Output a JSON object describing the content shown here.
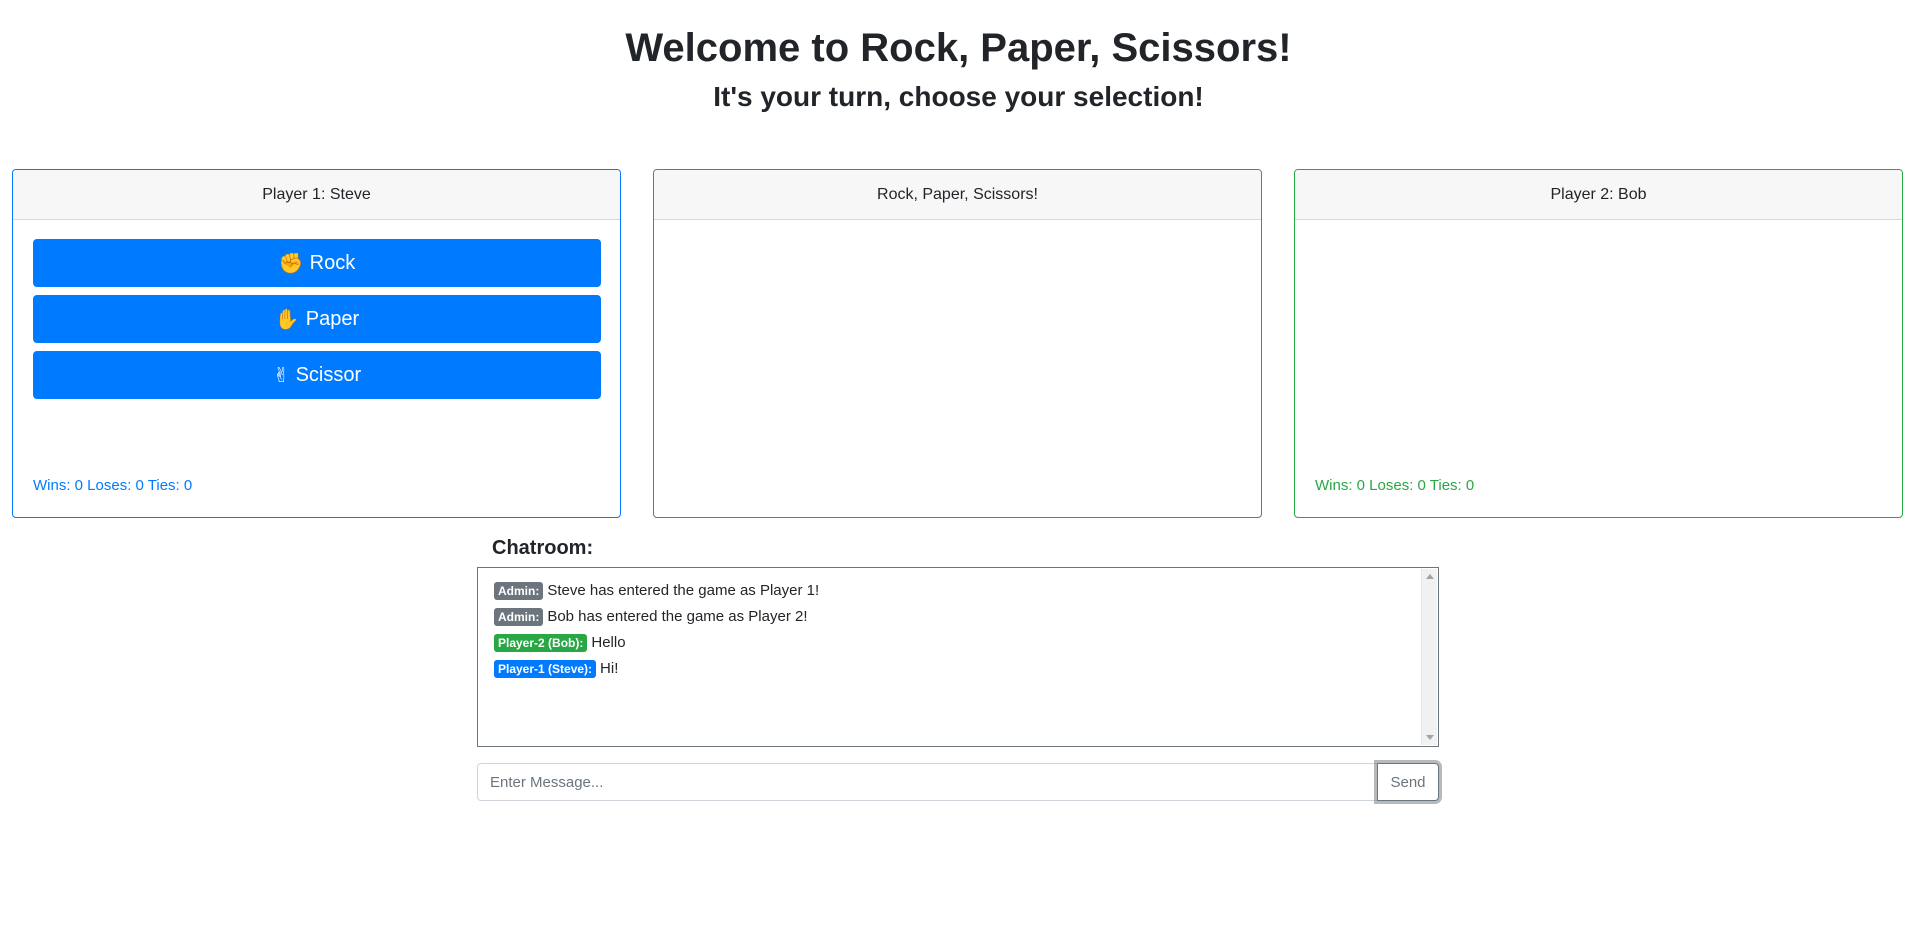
{
  "header": {
    "title": "Welcome to Rock, Paper, Scissors!",
    "subtitle": "It's your turn, choose your selection!"
  },
  "player1": {
    "header": "Player 1: Steve",
    "buttons": [
      {
        "label": "Rock",
        "icon": "hand-rock-icon"
      },
      {
        "label": "Paper",
        "icon": "hand-paper-icon"
      },
      {
        "label": "Scissor",
        "icon": "hand-scissors-icon"
      }
    ],
    "stats": "Wins: 0 Loses: 0 Ties: 0",
    "color": "#007bff"
  },
  "arena": {
    "header": "Rock, Paper, Scissors!"
  },
  "player2": {
    "header": "Player 2: Bob",
    "stats": "Wins: 0 Loses: 0 Ties: 0",
    "color": "#28a745"
  },
  "chat": {
    "label": "Chatroom:",
    "messages": [
      {
        "sender": "Admin:",
        "text": "Steve has entered the game as Player 1!",
        "badge_color": "#6c757d"
      },
      {
        "sender": "Admin:",
        "text": "Bob has entered the game as Player 2!",
        "badge_color": "#6c757d"
      },
      {
        "sender": "Player-2 (Bob):",
        "text": "Hello",
        "badge_color": "#28a745"
      },
      {
        "sender": "Player-1 (Steve):",
        "text": "Hi!",
        "badge_color": "#007bff"
      }
    ],
    "input_placeholder": "Enter Message...",
    "input_value": "",
    "send_label": "Send"
  }
}
